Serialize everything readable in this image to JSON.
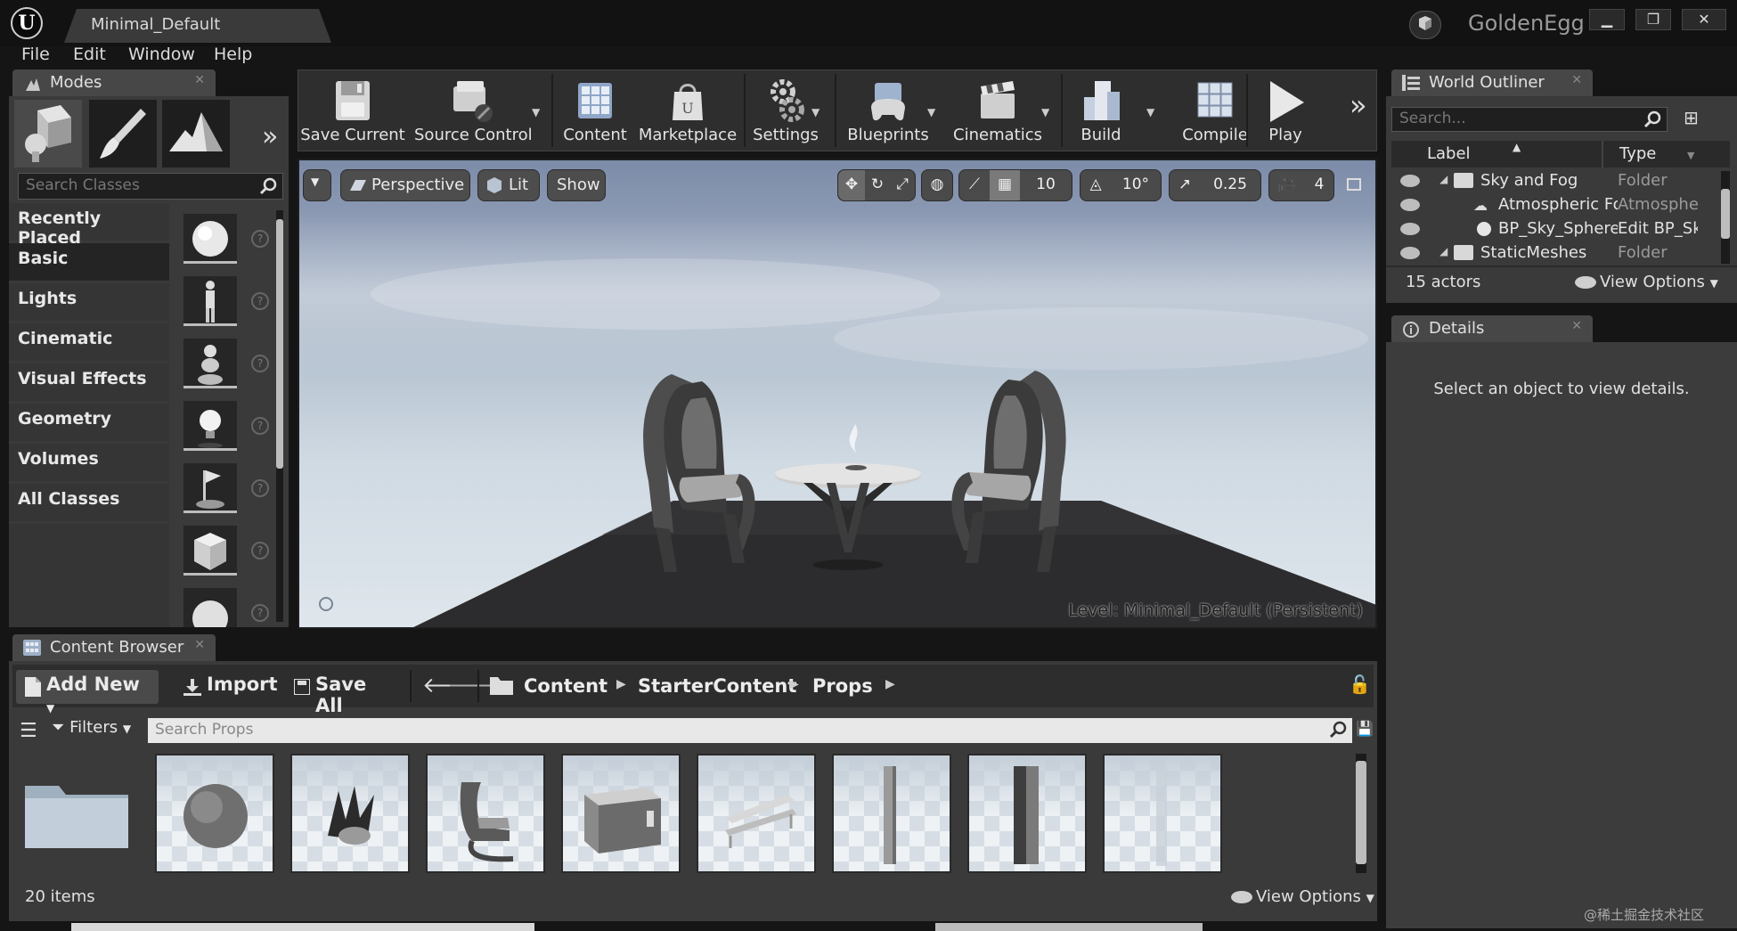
{
  "window": {
    "document_tab": "Minimal_Default",
    "project_name": "GoldenEgg",
    "minimize": "▁",
    "restore": "❐",
    "close": "✕"
  },
  "menu": [
    "File",
    "Edit",
    "Window",
    "Help"
  ],
  "modes": {
    "tab_label": "Modes",
    "search_placeholder": "Search Classes",
    "expand_icon": "»",
    "categories": [
      "Recently Placed",
      "Basic",
      "Lights",
      "Cinematic",
      "Visual Effects",
      "Geometry",
      "Volumes",
      "All Classes"
    ],
    "selected_category": "Basic",
    "help_glyph": "?"
  },
  "toolbar": {
    "buttons": [
      "Save Current",
      "Source Control",
      "Content",
      "Marketplace",
      "Settings",
      "Blueprints",
      "Cinematics",
      "Build",
      "Compile",
      "Play"
    ],
    "more_icon": "»"
  },
  "viewport": {
    "menu_glyph": "▼",
    "perspective": "Perspective",
    "lit": "Lit",
    "show": "Show",
    "grid_snap": "10",
    "rotation_snap": "10°",
    "scale_snap": "0.25",
    "camera_speed": "4",
    "level_prefix": "Level:",
    "level_name": "Minimal_Default (Persistent)"
  },
  "world_outliner": {
    "tab_label": "World Outliner",
    "search_placeholder": "Search...",
    "col_label": "Label",
    "col_type": "Type",
    "rows": [
      {
        "name": "Sky and Fog",
        "type": "Folder"
      },
      {
        "name": "Atmospheric Fo",
        "type": "Atmospher"
      },
      {
        "name": "BP_Sky_Sphere",
        "type": "Edit BP_Sk"
      },
      {
        "name": "StaticMeshes",
        "type": "Folder"
      }
    ],
    "actor_count": "15 actors",
    "view_options": "View Options"
  },
  "details": {
    "tab_label": "Details",
    "empty_message": "Select an object to view details."
  },
  "content_browser": {
    "tab_label": "Content Browser",
    "add_new": "Add New",
    "import": "Import",
    "save_all": "Save All",
    "breadcrumb": [
      "Content",
      "StarterContent",
      "Props"
    ],
    "filters": "Filters",
    "search_placeholder": "Search Props",
    "item_count": "20 items",
    "view_options": "View Options"
  },
  "watermark": "@稀土掘金技术社区",
  "colors": {
    "panel": "#3a3a3a",
    "toolbar": "#2e2e2e",
    "background": "#151515",
    "sky_top": "#7c8ba8",
    "sky_bottom": "#dfe6ec"
  }
}
